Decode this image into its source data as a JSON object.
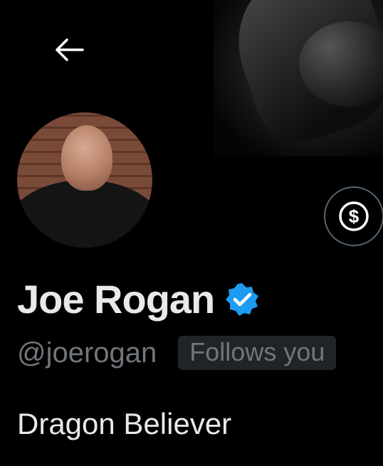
{
  "header": {
    "back_icon": "arrow-left-icon"
  },
  "profile": {
    "display_name": "Joe Rogan",
    "handle": "@joerogan",
    "follows_you_label": "Follows you",
    "bio": "Dragon Believer",
    "verified_icon": "verified-badge-icon",
    "tip_icon": "dollar-sign-icon"
  },
  "colors": {
    "background": "#000000",
    "text_primary": "#e7e9ea",
    "text_secondary": "#71767b",
    "verified_blue": "#1d9bf0",
    "badge_bg": "#202327"
  }
}
